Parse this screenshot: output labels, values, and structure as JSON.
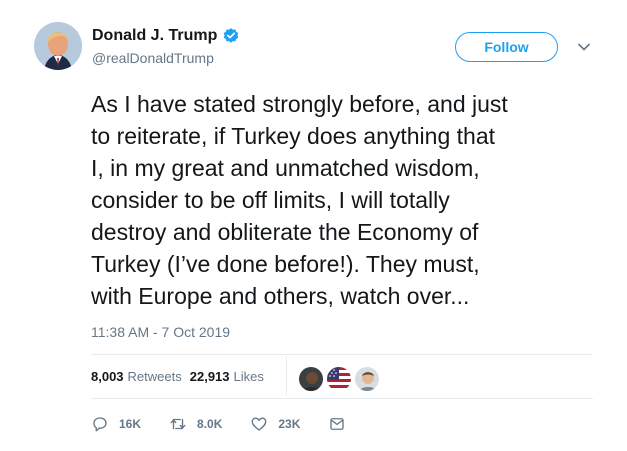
{
  "author": {
    "name": "Donald J. Trump",
    "handle": "@realDonaldTrump",
    "verified": true,
    "avatar": "avatar-icon"
  },
  "follow_label": "Follow",
  "tweet": {
    "text": "As I have stated strongly before, and just\nto reiterate, if Turkey does anything that\nI, in my great and unmatched wisdom,\nconsider to be off limits, I will totally\ndestroy and obliterate the Economy of\nTurkey (I’ve done before!). They must,\nwith Europe and others, watch over...",
    "timestamp": "11:38 AM - 7 Oct 2019"
  },
  "stats": {
    "retweets_count": "8,003",
    "retweets_label": "Retweets",
    "likes_count": "22,913",
    "likes_label": "Likes"
  },
  "liker_avatars": [
    "liker-avatar-1",
    "liker-avatar-flag",
    "liker-avatar-3"
  ],
  "actions": {
    "reply_count": "16K",
    "retweet_count": "8.0K",
    "like_count": "23K"
  },
  "colors": {
    "accent": "#1da1f2",
    "text": "#14171a",
    "secondary": "#657786",
    "divider": "#e6ecf0"
  }
}
